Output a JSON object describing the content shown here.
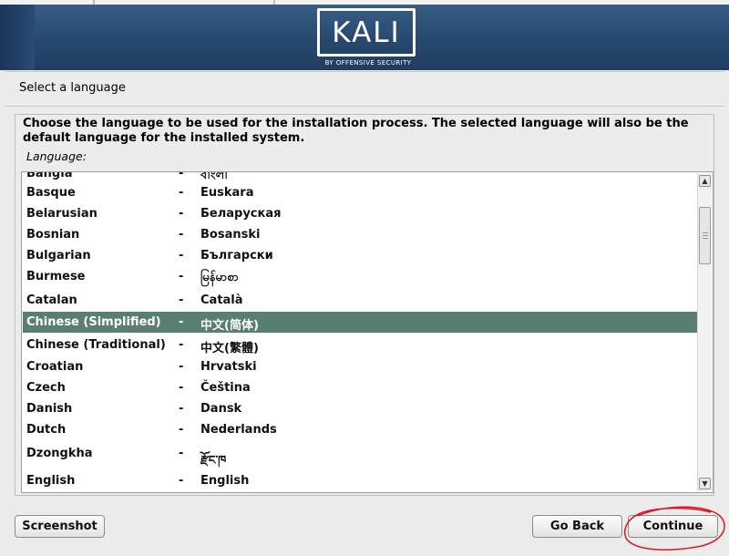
{
  "header": {
    "logo_text": "KALI",
    "logo_subtitle": "BY OFFENSIVE SECURITY"
  },
  "step_title": "Select a language",
  "description": "Choose the language to be used for the installation process. The selected language will also be the default language for the installed system.",
  "language_label": "Language:",
  "languages": [
    {
      "name": "Bangla",
      "native": "বাংলা"
    },
    {
      "name": "Basque",
      "native": "Euskara"
    },
    {
      "name": "Belarusian",
      "native": "Беларуская"
    },
    {
      "name": "Bosnian",
      "native": "Bosanski"
    },
    {
      "name": "Bulgarian",
      "native": "Български"
    },
    {
      "name": "Burmese",
      "native": "မြန်မာစာ"
    },
    {
      "name": "Catalan",
      "native": "Català"
    },
    {
      "name": "Chinese (Simplified)",
      "native": "中文(简体)"
    },
    {
      "name": "Chinese (Traditional)",
      "native": "中文(繁體)"
    },
    {
      "name": "Croatian",
      "native": "Hrvatski"
    },
    {
      "name": "Czech",
      "native": "Čeština"
    },
    {
      "name": "Danish",
      "native": "Dansk"
    },
    {
      "name": "Dutch",
      "native": "Nederlands"
    },
    {
      "name": "Dzongkha",
      "native": "རྫོང་ཁ"
    },
    {
      "name": "English",
      "native": "English"
    }
  ],
  "separator": "-",
  "selected_language": "Chinese (Simplified)",
  "buttons": {
    "screenshot": "Screenshot",
    "back": "Go Back",
    "continue": "Continue"
  },
  "colors": {
    "banner": "#26486f",
    "selection": "#587f6f",
    "annotation": "#e0141e"
  },
  "icons": {
    "scroll_up": "triangle-up-icon",
    "scroll_down": "triangle-down-icon"
  }
}
